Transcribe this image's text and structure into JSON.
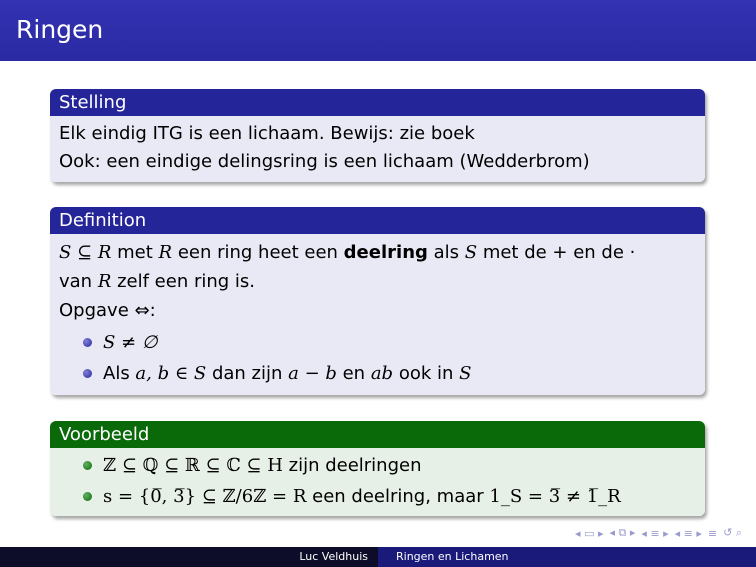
{
  "slide": {
    "title": "Ringen"
  },
  "blocks": {
    "stelling": {
      "header": "Stelling",
      "line1": "Elk eindig ITG is een lichaam. Bewijs: zie boek",
      "line2": "Ook: een eindige delingsring is een lichaam (Wedderbrom)"
    },
    "definition": {
      "header": "Definition",
      "l1_a": "S ⊆ R",
      "l1_b": " met ",
      "l1_c": "R",
      "l1_d": " een ring heet een ",
      "l1_bold": "deelring",
      "l1_e": " als ",
      "l1_f": "S",
      "l1_g": " met de + en de ·",
      "l2_a": "van ",
      "l2_b": "R",
      "l2_c": " zelf een ring is.",
      "l3": "Opgave ⇔:",
      "bullet1": "S ≠ ∅",
      "bullet2_a": "Als ",
      "bullet2_b": "a, b ∈ S",
      "bullet2_c": " dan zijn ",
      "bullet2_d": "a − b",
      "bullet2_e": " en ",
      "bullet2_f": "ab",
      "bullet2_g": " ook in ",
      "bullet2_h": "S"
    },
    "voorbeeld": {
      "header": "Voorbeeld",
      "bullet1_math": "ℤ ⊆ ℚ ⊆ ℝ ⊆ ℂ ⊆ H",
      "bullet1_text": " zijn deelringen",
      "bullet2_a": "s = {0̅, 3̅} ⊆ ℤ/6ℤ = R",
      "bullet2_b": " een deelring, maar ",
      "bullet2_c": "1_S = 3̅ ≠ 1̅_R"
    }
  },
  "footer": {
    "author": "Luc Veldhuis",
    "title": "Ringen en Lichamen"
  }
}
